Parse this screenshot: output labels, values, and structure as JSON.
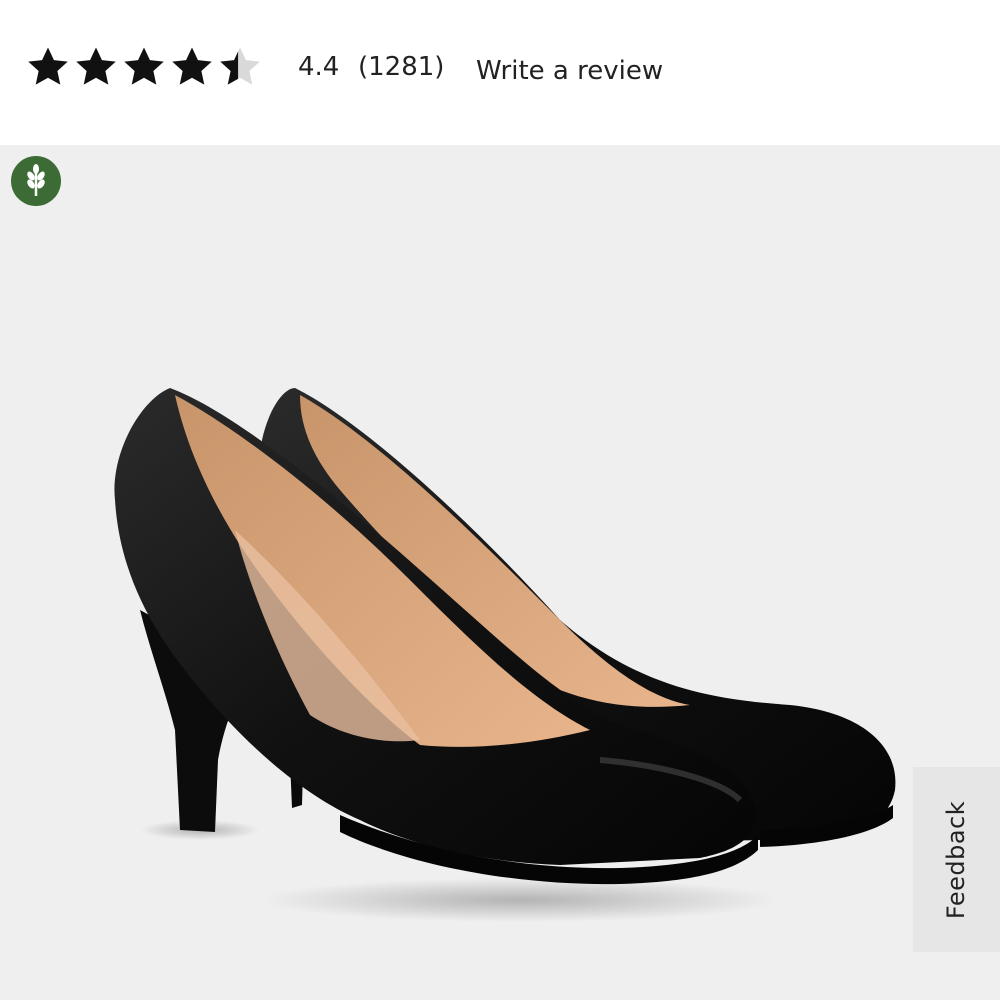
{
  "rating": {
    "value_text": "4.4",
    "value": 4.4,
    "max": 5,
    "count_text": "(1281)",
    "write_review_label": "Write a review"
  },
  "product_image": {
    "alt": "Black leather round-toe pumps"
  },
  "badge": {
    "icon": "wheat-icon",
    "color": "#3d6b35"
  },
  "feedback": {
    "label": "Feedback"
  }
}
